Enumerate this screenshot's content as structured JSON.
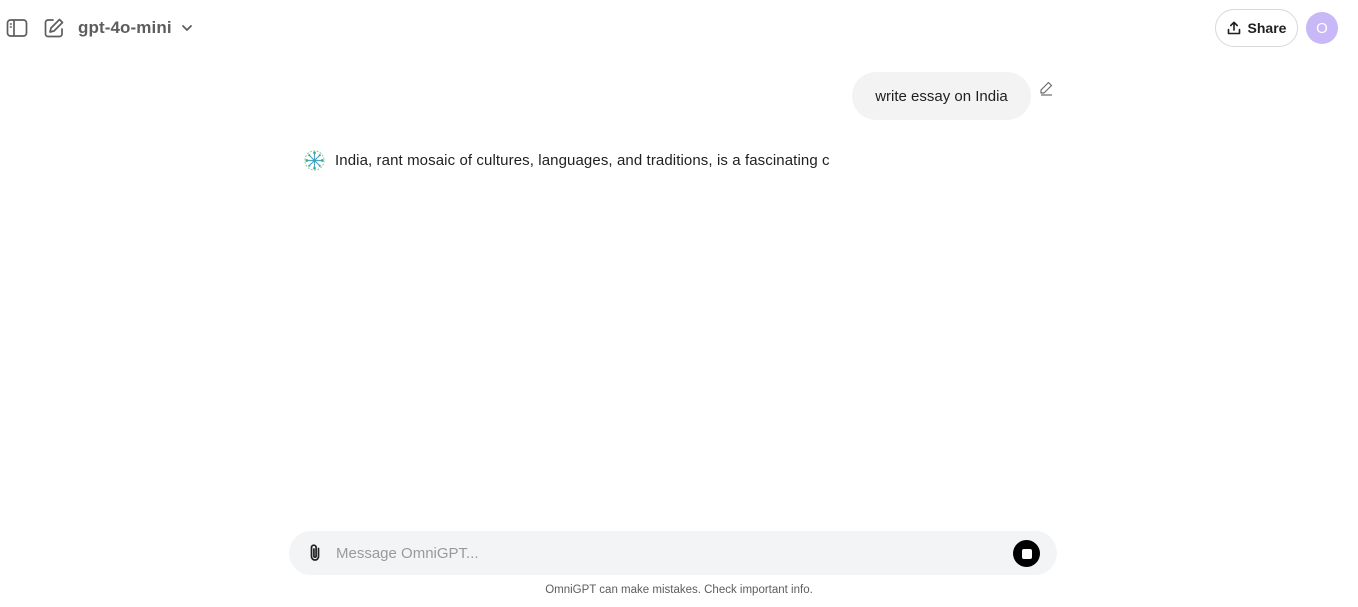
{
  "header": {
    "model_name": "gpt-4o-mini",
    "share_label": "Share",
    "avatar_initial": "O",
    "icons": {
      "sidebar": "sidebar-toggle-icon",
      "new_chat": "new-chat-icon",
      "chevron": "chevron-down-icon",
      "share": "upload-icon"
    }
  },
  "conversation": {
    "user_message": "write essay on India",
    "assistant_message": "India, rant mosaic of cultures, languages, and traditions, is a fascinating c"
  },
  "composer": {
    "placeholder": "Message OmniGPT...",
    "value": ""
  },
  "footer": {
    "disclaimer": "OmniGPT can make mistakes. Check important info."
  },
  "colors": {
    "avatar_bg": "#c9b8f7",
    "bubble_bg": "#f3f3f3",
    "composer_bg": "#f3f4f6",
    "stop_button": "#000000"
  }
}
